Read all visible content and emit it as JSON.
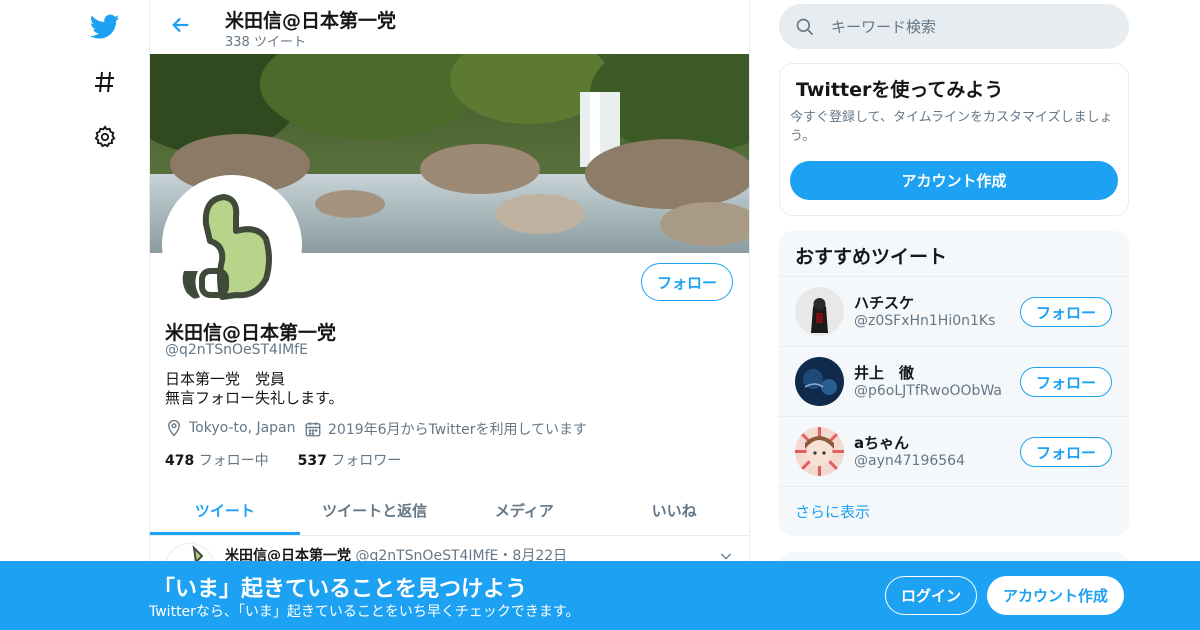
{
  "nav": {
    "icons": [
      "twitter-bird-icon",
      "hashtag-icon",
      "settings-gear-icon"
    ]
  },
  "header": {
    "title": "米田信@日本第一党",
    "tweet_count": "338 ツイート"
  },
  "profile": {
    "name": "米田信@日本第一党",
    "handle": "@q2nTSnOeST4IMfE",
    "bio_line1": "日本第一党　党員",
    "bio_line2": "無言フォロー失礼します。",
    "location": "Tokyo-to, Japan",
    "joined": "2019年6月からTwitterを利用しています",
    "following_count": "478",
    "following_label": "フォロー中",
    "followers_count": "537",
    "followers_label": "フォロワー",
    "follow_label": "フォロー"
  },
  "tabs": [
    "ツイート",
    "ツイートと返信",
    "メディア",
    "いいね"
  ],
  "tweet_peek": {
    "name": "米田信@日本第一党",
    "handle": "@q2nTSnOeST4IMfE",
    "date": "・8月22日"
  },
  "search": {
    "placeholder": "キーワード検索"
  },
  "signup_card": {
    "title": "Twitterを使ってみよう",
    "text": "今すぐ登録して、タイムラインをカスタマイズしましょう。",
    "button": "アカウント作成"
  },
  "recommend": {
    "title": "おすすめツイート",
    "users": [
      {
        "name": "ハチスケ",
        "handle": "@z0SFxHn1Hi0n1Ks",
        "follow": "フォロー"
      },
      {
        "name": "井上　徹",
        "handle": "@p6oLJTfRwoOObWa",
        "follow": "フォロー"
      },
      {
        "name": "aちゃん",
        "handle": "@ayn47196564",
        "follow": "フォロー"
      }
    ],
    "more": "さらに表示"
  },
  "bottom_bar": {
    "title": "「いま」起きていることを見つけよう",
    "subtitle": "Twitterなら、「いま」起きていることをいち早くチェックできます。",
    "login": "ログイン",
    "signup": "アカウント作成"
  },
  "colors": {
    "brand": "#1da1f2",
    "muted": "#657786",
    "border": "#e6ecf0"
  }
}
